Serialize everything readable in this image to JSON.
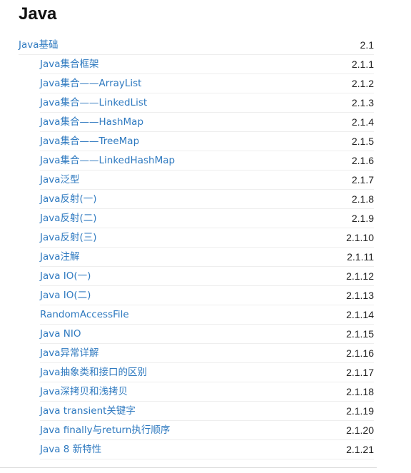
{
  "heading": "Java",
  "toc": [
    {
      "label": "Java基础",
      "number": "2.1",
      "level": 1
    },
    {
      "label": "Java集合框架",
      "number": "2.1.1",
      "level": 2
    },
    {
      "label": "Java集合——ArrayList",
      "number": "2.1.2",
      "level": 2
    },
    {
      "label": "Java集合——LinkedList",
      "number": "2.1.3",
      "level": 2
    },
    {
      "label": "Java集合——HashMap",
      "number": "2.1.4",
      "level": 2
    },
    {
      "label": "Java集合——TreeMap",
      "number": "2.1.5",
      "level": 2
    },
    {
      "label": "Java集合——LinkedHashMap",
      "number": "2.1.6",
      "level": 2
    },
    {
      "label": "Java泛型",
      "number": "2.1.7",
      "level": 2
    },
    {
      "label": "Java反射(一)",
      "number": "2.1.8",
      "level": 2
    },
    {
      "label": "Java反射(二)",
      "number": "2.1.9",
      "level": 2
    },
    {
      "label": "Java反射(三)",
      "number": "2.1.10",
      "level": 2
    },
    {
      "label": "Java注解",
      "number": "2.1.11",
      "level": 2
    },
    {
      "label": "Java IO(一)",
      "number": "2.1.12",
      "level": 2
    },
    {
      "label": "Java IO(二)",
      "number": "2.1.13",
      "level": 2
    },
    {
      "label": "RandomAccessFile",
      "number": "2.1.14",
      "level": 2
    },
    {
      "label": "Java NIO",
      "number": "2.1.15",
      "level": 2
    },
    {
      "label": "Java异常详解",
      "number": "2.1.16",
      "level": 2
    },
    {
      "label": "Java抽象类和接口的区别",
      "number": "2.1.17",
      "level": 2
    },
    {
      "label": "Java深拷贝和浅拷贝",
      "number": "2.1.18",
      "level": 2
    },
    {
      "label": "Java transient关键字",
      "number": "2.1.19",
      "level": 2
    },
    {
      "label": "Java finally与return执行顺序",
      "number": "2.1.20",
      "level": 2
    },
    {
      "label": "Java 8 新特性",
      "number": "2.1.21",
      "level": 2
    }
  ],
  "colors": {
    "link": "#2f7ac0",
    "number": "#222222",
    "heading": "#111111",
    "rule": "#eeeeee"
  }
}
